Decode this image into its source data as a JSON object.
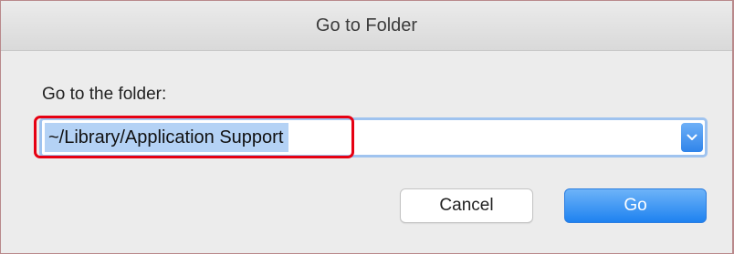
{
  "dialog": {
    "title": "Go to Folder",
    "prompt": "Go to the folder:",
    "path_value": "~/Library/Application Support",
    "dropdown_icon": "chevron-down-icon",
    "cancel_label": "Cancel",
    "go_label": "Go"
  },
  "colors": {
    "accent": "#2f84ea",
    "selection": "#b4d2f5",
    "highlight_annotation": "#e60012"
  }
}
